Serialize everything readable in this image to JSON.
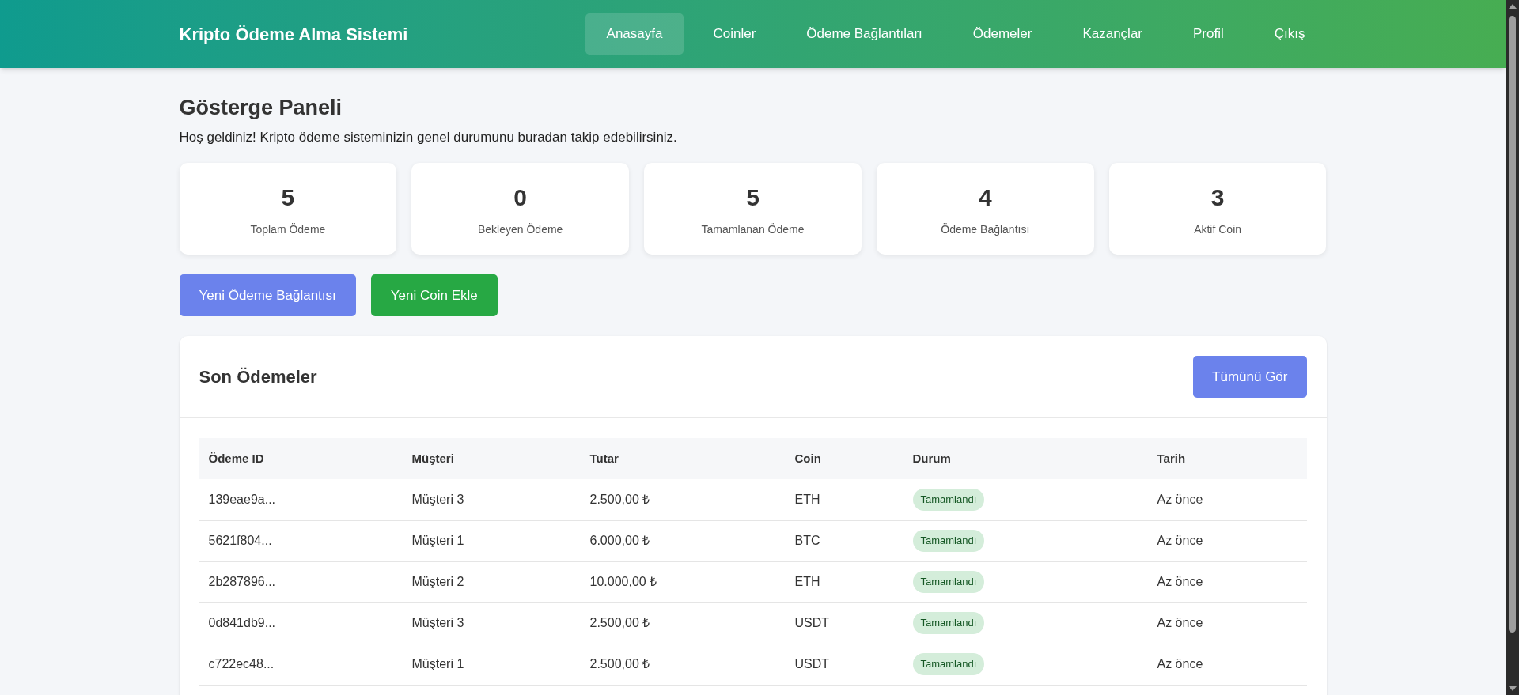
{
  "header": {
    "brand": "Kripto Ödeme Alma Sistemi",
    "nav": [
      {
        "label": "Anasayfa",
        "selected": true
      },
      {
        "label": "Coinler",
        "selected": false
      },
      {
        "label": "Ödeme Bağlantıları",
        "selected": false
      },
      {
        "label": "Ödemeler",
        "selected": false
      },
      {
        "label": "Kazançlar",
        "selected": false
      },
      {
        "label": "Profil",
        "selected": false
      },
      {
        "label": "Çıkış",
        "selected": false
      }
    ]
  },
  "page": {
    "title": "Gösterge Paneli",
    "subtitle": "Hoş geldiniz! Kripto ödeme sisteminizin genel durumunu buradan takip edebilirsiniz."
  },
  "stats": [
    {
      "value": "5",
      "label": "Toplam Ödeme"
    },
    {
      "value": "0",
      "label": "Bekleyen Ödeme"
    },
    {
      "value": "5",
      "label": "Tamamlanan Ödeme"
    },
    {
      "value": "4",
      "label": "Ödeme Bağlantısı"
    },
    {
      "value": "3",
      "label": "Aktif Coin"
    }
  ],
  "actions": [
    {
      "label": "Yeni Ödeme Bağlantısı",
      "kind": "primary"
    },
    {
      "label": "Yeni Coin Ekle",
      "kind": "success"
    }
  ],
  "recent_payments": {
    "title": "Son Ödemeler",
    "button": "Tümünü Gör",
    "columns": [
      "Ödeme ID",
      "Müşteri",
      "Tutar",
      "Coin",
      "Durum",
      "Tarih"
    ],
    "rows": [
      {
        "id": "139eae9a...",
        "customer": "Müşteri 3",
        "amount": "2.500,00 ₺",
        "coin": "ETH",
        "status": "Tamamlandı",
        "kind": "completed",
        "date": "Az önce"
      },
      {
        "id": "5621f804...",
        "customer": "Müşteri 1",
        "amount": "6.000,00 ₺",
        "coin": "BTC",
        "status": "Tamamlandı",
        "kind": "completed",
        "date": "Az önce"
      },
      {
        "id": "2b287896...",
        "customer": "Müşteri 2",
        "amount": "10.000,00 ₺",
        "coin": "ETH",
        "status": "Tamamlandı",
        "kind": "completed",
        "date": "Az önce"
      },
      {
        "id": "0d841db9...",
        "customer": "Müşteri 3",
        "amount": "2.500,00 ₺",
        "coin": "USDT",
        "status": "Tamamlandı",
        "kind": "completed",
        "date": "Az önce"
      },
      {
        "id": "c722ec48...",
        "customer": "Müşteri 1",
        "amount": "2.500,00 ₺",
        "coin": "USDT",
        "status": "Tamamlandı",
        "kind": "completed",
        "date": "Az önce"
      }
    ]
  }
}
